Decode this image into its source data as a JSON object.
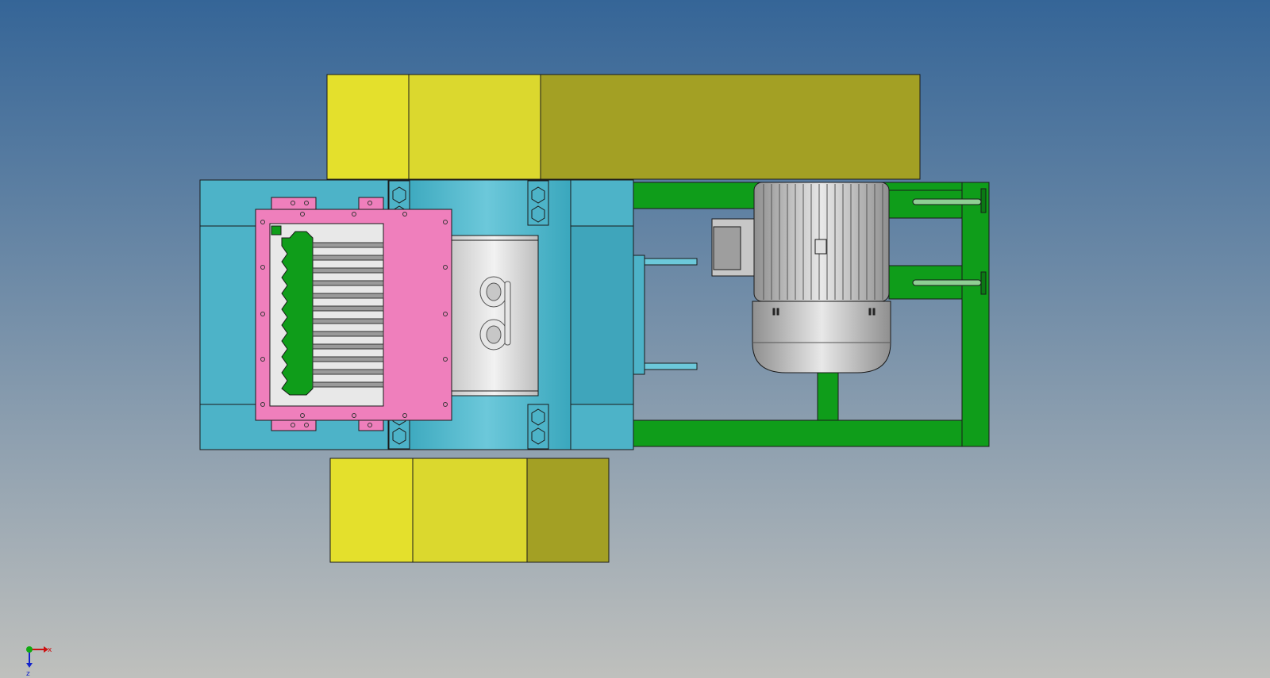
{
  "viewport": {
    "background_top": "#356597",
    "background_bottom": "#bfc0bd"
  },
  "colors": {
    "hopper_yellow_light": "#e4e02c",
    "hopper_yellow_mid": "#dbd82e",
    "hopper_yellow_dark": "#a3a024",
    "housing_blue": "#4db3c8",
    "housing_blue_dark": "#3a9fb5",
    "frame_green": "#0f9d1a",
    "flange_pink": "#ef7fbc",
    "rotor_grey": "#d9d9d9",
    "motor_grey": "#b5b5b5",
    "edge": "#1a1a1a"
  },
  "icons": {
    "triad": "xyz-axis-triad-icon",
    "motor": "electric-motor-icon",
    "eyebolt": "eyebolt-icon"
  },
  "axis_triad": {
    "x_label": "x",
    "z_label": "z",
    "x_color": "#cc1111",
    "y_color": "#11aa11",
    "z_color": "#1122cc"
  }
}
